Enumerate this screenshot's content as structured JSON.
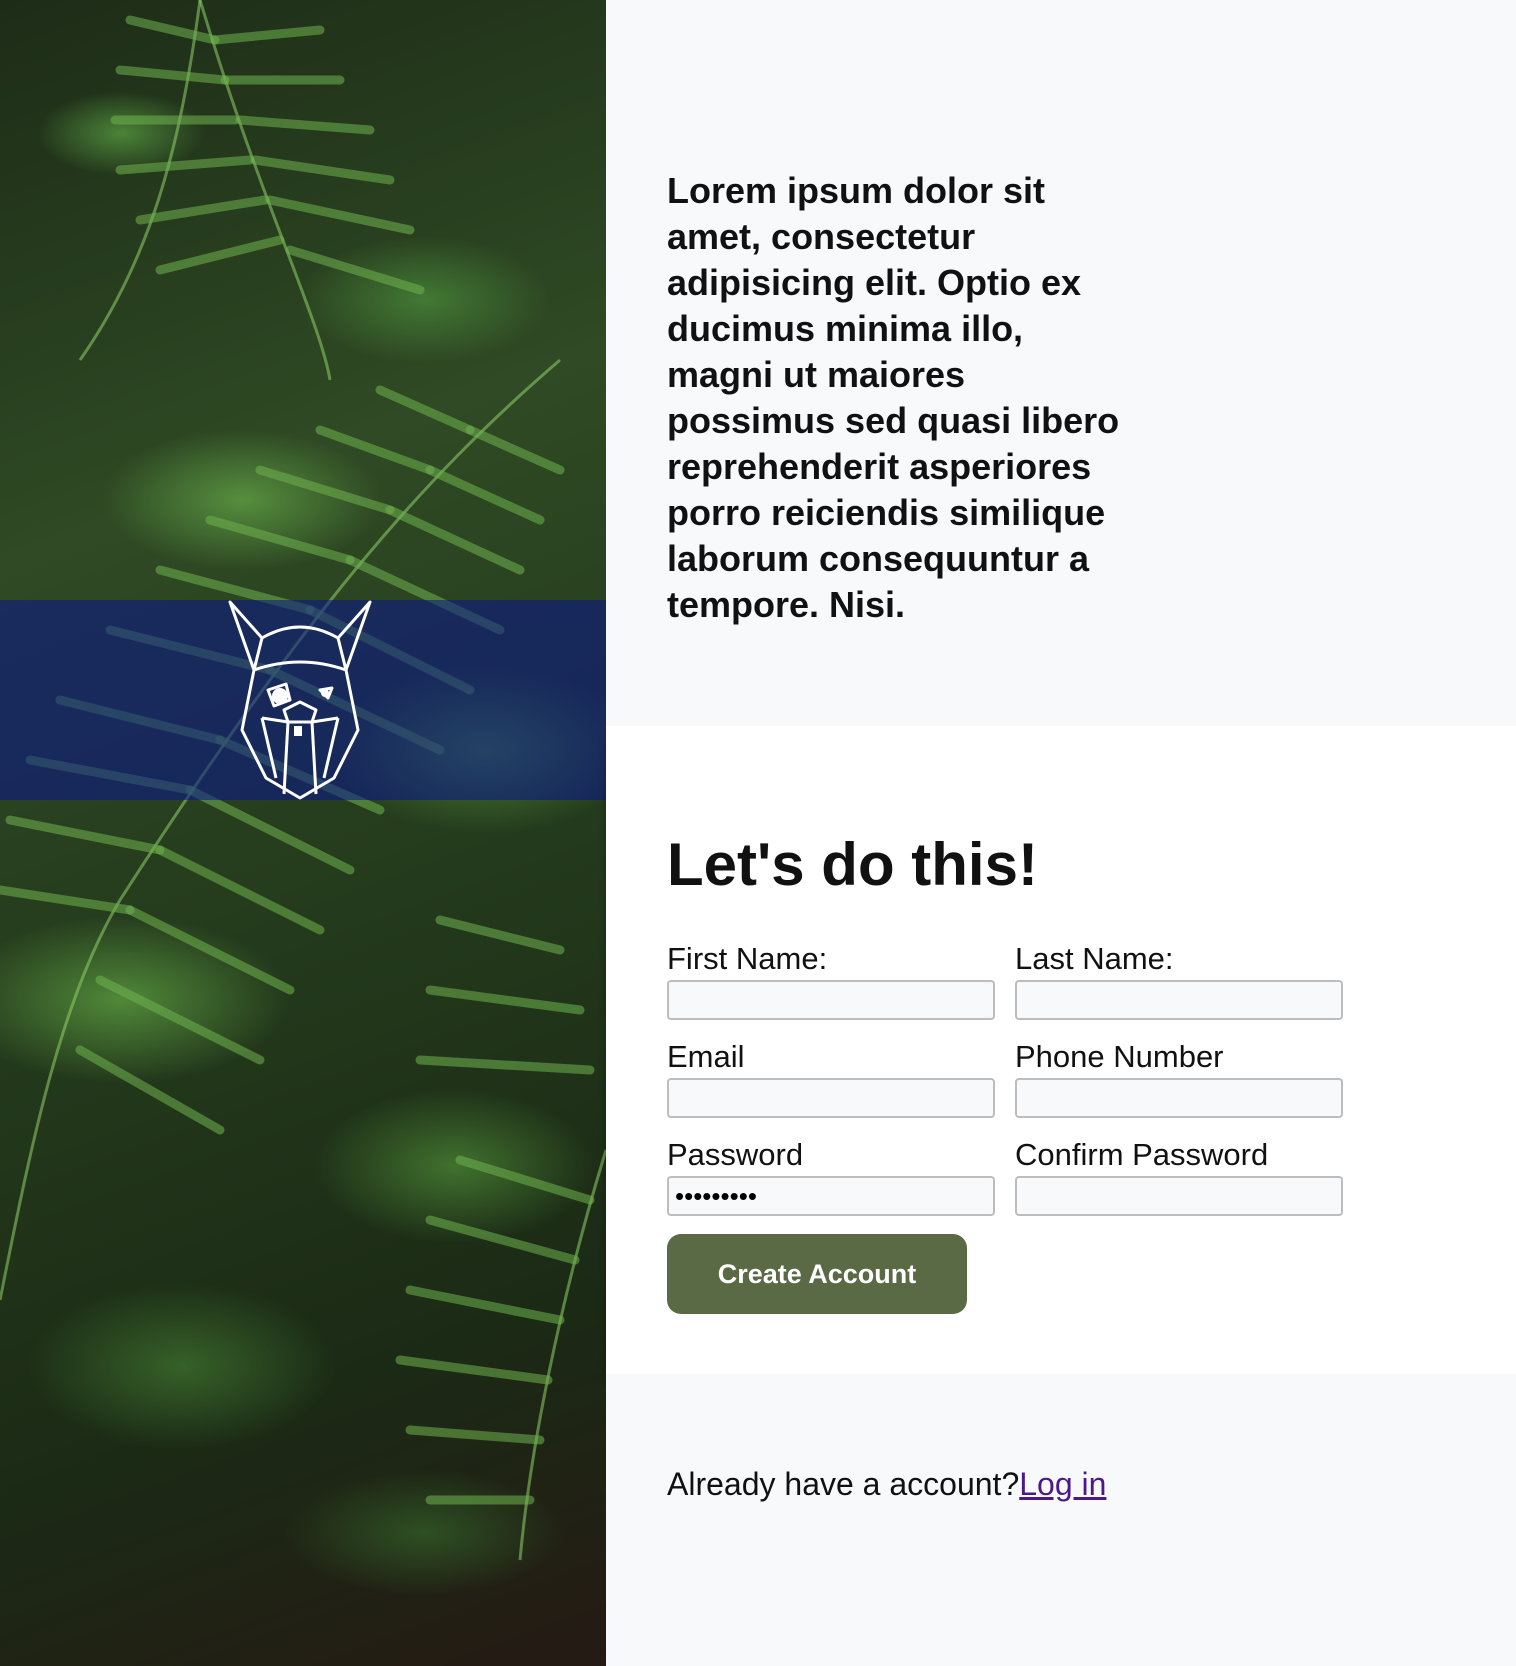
{
  "intro": {
    "text": "Lorem ipsum dolor sit amet, consectetur adipisicing elit. Optio ex ducimus minima illo, magni ut maiores possimus sed quasi libero reprehenderit asperiores porro reiciendis similique laborum consequuntur a tempore. Nisi."
  },
  "form": {
    "title": "Let's do this!",
    "first_name_label": "First Name:",
    "first_name_value": "",
    "last_name_label": "Last Name:",
    "last_name_value": "",
    "email_label": "Email",
    "email_value": "",
    "phone_label": "Phone Number",
    "phone_value": "",
    "password_label": "Password",
    "password_value": "•••••••••",
    "confirm_password_label": "Confirm Password",
    "confirm_password_value": "",
    "submit_label": "Create Account"
  },
  "footer": {
    "prompt": "Already have a account?",
    "login_link": "Log in"
  },
  "colors": {
    "button_bg": "#5a6a45",
    "logo_band": "#0a148c",
    "link": "#4b1a8a"
  },
  "icons": {
    "logo": "viking-head-icon"
  }
}
